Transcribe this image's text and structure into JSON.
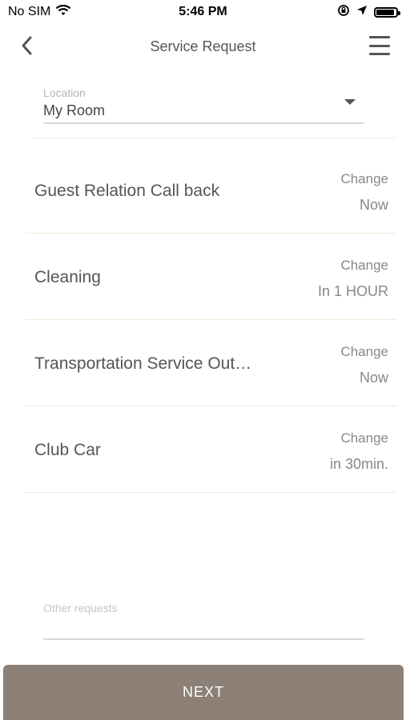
{
  "status_bar": {
    "carrier": "No SIM",
    "time": "5:46 PM",
    "icons": [
      "wifi-icon",
      "orientation-lock-icon",
      "location-arrow-icon",
      "battery-icon"
    ],
    "battery_level": 0.85
  },
  "nav": {
    "title": "Service Request",
    "back_icon": "chevron-left-icon",
    "menu_icon": "hamburger-menu-icon"
  },
  "location": {
    "label": "Location",
    "value": "My Room"
  },
  "services": [
    {
      "name": "Guest Relation Call back",
      "change_label": "Change",
      "time": "Now"
    },
    {
      "name": "Cleaning",
      "change_label": "Change",
      "time": "In 1 HOUR"
    },
    {
      "name": "Transportation Service Out…",
      "change_label": "Change",
      "time": "Now"
    },
    {
      "name": "Club Car",
      "change_label": "Change",
      "time": "in 30min."
    }
  ],
  "other_requests": {
    "placeholder": "Other requests",
    "value": ""
  },
  "next_button": {
    "label": "NEXT"
  },
  "colors": {
    "button_bg": "#8c8077",
    "row_divider": "#ecebd5"
  }
}
